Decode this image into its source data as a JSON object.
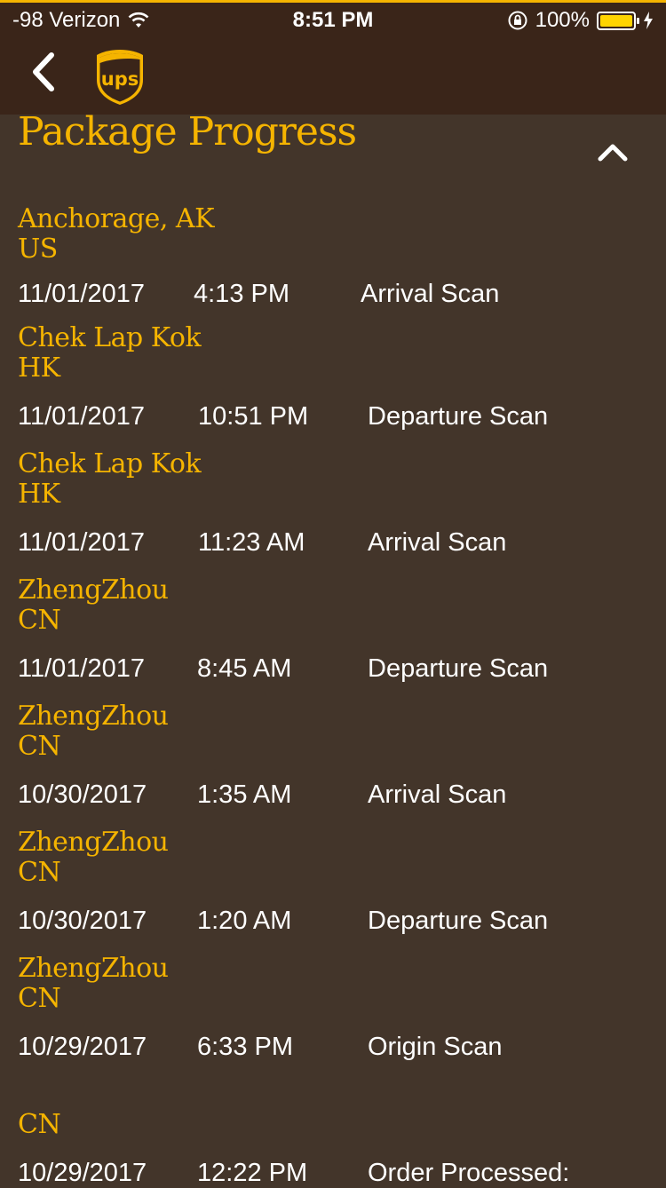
{
  "status_bar": {
    "carrier": "-98 Verizon",
    "time": "8:51 PM",
    "battery": "100%",
    "icons": [
      "wifi-icon",
      "orientation-lock-icon",
      "battery-icon",
      "charging-bolt-icon"
    ]
  },
  "nav": {
    "back_icon": "back-chevron-icon",
    "logo_text": "ups"
  },
  "title": "Package Progress",
  "collapse_icon": "chevron-up-icon",
  "colors": {
    "accent": "#f5b400",
    "background": "#43352a",
    "header": "#3a2519",
    "text": "#ffffff"
  },
  "entries": [
    {
      "location_line1": "Anchorage, AK",
      "location_line2": "US",
      "date": "11/01/2017",
      "time": "4:13 PM",
      "activity": "Arrival Scan"
    },
    {
      "location_line1": "Chek Lap Kok",
      "location_line2": "HK",
      "date": "11/01/2017",
      "time": "10:51 PM",
      "activity": "Departure Scan"
    },
    {
      "location_line1": "Chek Lap Kok",
      "location_line2": "HK",
      "date": "11/01/2017",
      "time": "11:23 AM",
      "activity": "Arrival Scan"
    },
    {
      "location_line1": "ZhengZhou",
      "location_line2": "CN",
      "date": "11/01/2017",
      "time": "8:45 AM",
      "activity": "Departure Scan"
    },
    {
      "location_line1": "ZhengZhou",
      "location_line2": "CN",
      "date": "10/30/2017",
      "time": "1:35 AM",
      "activity": "Arrival Scan"
    },
    {
      "location_line1": "ZhengZhou",
      "location_line2": "CN",
      "date": "10/30/2017",
      "time": "1:20 AM",
      "activity": "Departure Scan"
    },
    {
      "location_line1": "ZhengZhou",
      "location_line2": "CN",
      "date": "10/29/2017",
      "time": "6:33 PM",
      "activity": "Origin Scan"
    },
    {
      "location_line1": "",
      "location_line2": "CN",
      "date": "10/29/2017",
      "time": "12:22 PM",
      "activity": "Order Processed:"
    }
  ]
}
